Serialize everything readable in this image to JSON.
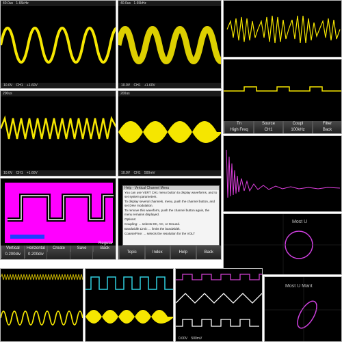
{
  "panels": {
    "p1": {
      "status": [
        "40.0us",
        "1.65kHz"
      ],
      "bottom": [
        "10.0V",
        "CH1",
        "+1.60V"
      ]
    },
    "p2": {
      "status": [
        "40.0us",
        "1.65kHz"
      ],
      "bottom": [
        "10.0V",
        "CH1",
        "+1.60V"
      ]
    },
    "p4": {
      "bottom": [
        "10.0V",
        "CH1",
        "+1.60V"
      ]
    },
    "p5": {
      "bottom": [
        "10.0V",
        "CH1",
        "500mV"
      ]
    },
    "p6": {
      "menu": [
        {
          "top": "Tn",
          "label": "Source",
          "value": "CH1"
        },
        {
          "top": "Coupling",
          "label": "Coupl",
          "value": "100kHz"
        },
        {
          "top": "Filter",
          "label": "",
          "value": ""
        },
        {
          "top": "",
          "label": "Back",
          "value": ""
        }
      ],
      "menu_first": "High Freq"
    },
    "p8": {
      "status": [
        "Regular"
      ],
      "menu": [
        "Vertical",
        "Horizontal",
        "Create",
        "Save",
        "Back"
      ],
      "menu_values": [
        "0.200div",
        "0.200div"
      ]
    },
    "p9": {
      "title": "Help - Vertical Channel Menu",
      "lines": [
        "You can use VERT CH1 menu button to display waveforms, and to set system parameters.",
        "To display several channels, menu, push the channel button, and set DHA modulation.",
        "To remove this waveform, push the channel button again, the menu remains displayed.",
        "Options:",
        "Coupling: ... selects DC, AC, or Ground.",
        "Bandwidth Limit: ... limits the bandwidth.",
        "Coarse/Fine: ... selects the resolution for the VOLT"
      ],
      "menu": [
        "Topic",
        "Index",
        "Help",
        "Back"
      ]
    },
    "p10": {
      "watermark": "Most U"
    },
    "p14": {
      "bottom": [
        "0.00V",
        "500mV"
      ]
    },
    "p15": {
      "watermark": "Most U  Mant"
    }
  }
}
